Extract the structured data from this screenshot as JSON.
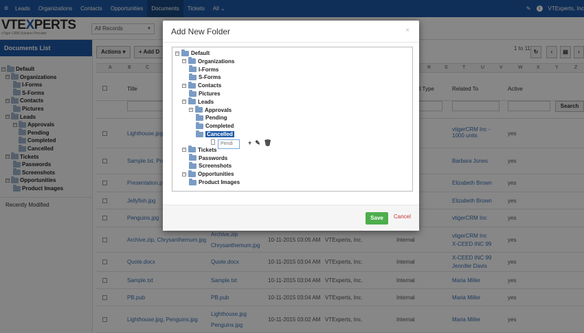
{
  "nav": {
    "menu_icon": "grid-icon",
    "items": [
      "Leads",
      "Organizations",
      "Contacts",
      "Opportunities",
      "Documents",
      "Tickets",
      "All"
    ],
    "active": "Documents",
    "user": "VTExperts, Inc"
  },
  "logo": {
    "text_a": "VTE",
    "text_x": "X",
    "text_b": "PERTS",
    "tagline": "vTiger CRM Solution Provider"
  },
  "records": {
    "value": "All Records"
  },
  "sidebar": {
    "title": "Documents List",
    "tree": [
      {
        "label": "Default",
        "level": 0
      },
      {
        "label": "Organizations",
        "level": 1
      },
      {
        "label": "I-Forms",
        "level": 2
      },
      {
        "label": "S-Forms",
        "level": 2
      },
      {
        "label": "Contacts",
        "level": 1
      },
      {
        "label": "Pictures",
        "level": 2
      },
      {
        "label": "Leads",
        "level": 1
      },
      {
        "label": "Approvals",
        "level": 2
      },
      {
        "label": "Pending",
        "level": 3
      },
      {
        "label": "Completed",
        "level": 3
      },
      {
        "label": "Cancelled",
        "level": 3
      },
      {
        "label": "Tickets",
        "level": 1
      },
      {
        "label": "Passwords",
        "level": 2
      },
      {
        "label": "Screenshots",
        "level": 2
      },
      {
        "label": "Opportunities",
        "level": 1
      },
      {
        "label": "Product Images",
        "level": 2
      }
    ],
    "recent": "Recently Modified"
  },
  "toolbar": {
    "actions": "Actions",
    "add": "+ Add D"
  },
  "pager": {
    "range": "1 to 11"
  },
  "alphabet": [
    "A",
    "B",
    "C",
    "R",
    "S",
    "T",
    "U",
    "V",
    "W",
    "X",
    "Y",
    "Z"
  ],
  "table": {
    "headers": {
      "title": "Title",
      "type": "d Type",
      "related": "Related To",
      "active": "Active"
    },
    "search": "Search",
    "rows": [
      {
        "title": "Lighthouse.jpg, ...",
        "file": "",
        "modified": "",
        "owner": "",
        "type": "",
        "related": "vtigerCRM Inc - 1000 units",
        "active": "yes"
      },
      {
        "title": "Sample.txt, Prop",
        "file": "",
        "modified": "",
        "owner": "",
        "type": "",
        "related": "Barbara Jones",
        "active": "yes"
      },
      {
        "title": "Presentation.pp",
        "file": "",
        "modified": "",
        "owner": "",
        "type": "",
        "related": "Elizabeth Brown",
        "active": "yes"
      },
      {
        "title": "Jellyfish.jpg",
        "file": "",
        "modified": "",
        "owner": "",
        "type": "",
        "related": "Elizabeth Brown",
        "active": "yes"
      },
      {
        "title": "Penguins.jpg",
        "file": "",
        "modified": "",
        "owner": "",
        "type": "",
        "related": "vtigerCRM Inc",
        "active": "yes"
      },
      {
        "title": "Archive.zip, Chrysanthemum.jpg",
        "file": "Archive.zip",
        "file2": "Chrysanthemum.jpg",
        "modified": "10-11-2015 03:05 AM",
        "owner": "VTExperts, Inc.",
        "type": "Internal",
        "related": "vtigerCRM Inc",
        "related2": "X-CEED INC 99",
        "active": "yes"
      },
      {
        "title": "Quote.docx",
        "file": "Quote.docx",
        "modified": "10-11-2015 03:04 AM",
        "owner": "VTExperts, Inc.",
        "type": "Internal",
        "related": "X-CEED INC 99",
        "related2": "Jennifer Davis",
        "active": "yes"
      },
      {
        "title": "Sample.txt",
        "file": "Sample.txt",
        "modified": "10-11-2015 03:04 AM",
        "owner": "VTExperts, Inc.",
        "type": "Internal",
        "related": "Maria Miller",
        "active": "yes"
      },
      {
        "title": "PB.pub",
        "file": "PB.pub",
        "modified": "10-11-2015 03:04 AM",
        "owner": "VTExperts, Inc.",
        "type": "Internal",
        "related": "Maria Miller",
        "active": "yes"
      },
      {
        "title": "Lighthouse.jpg, Penguins.jpg",
        "file": "Lighthouse.jpg",
        "file2": "Penguins.jpg",
        "modified": "10-11-2015 03:02 AM",
        "owner": "VTExperts, Inc.",
        "type": "Internal",
        "related": "Maria Miller",
        "active": "yes"
      }
    ]
  },
  "modal": {
    "title": "Add New Folder",
    "close": "×",
    "tree": [
      {
        "label": "Default"
      },
      {
        "label": "Organizations"
      },
      {
        "label": "I-Forms"
      },
      {
        "label": "S-Forms"
      },
      {
        "label": "Contacts"
      },
      {
        "label": "Pictures"
      },
      {
        "label": "Leads"
      },
      {
        "label": "Approvals"
      },
      {
        "label": "Pending"
      },
      {
        "label": "Completed"
      },
      {
        "label": "Cancelled",
        "selected": true
      },
      {
        "label": "Tickets"
      },
      {
        "label": "Passwords"
      },
      {
        "label": "Screenshots"
      },
      {
        "label": "Opportunities"
      },
      {
        "label": "Product Images"
      }
    ],
    "new_folder_value": "Pendi",
    "save": "Save",
    "cancel": "Cancel"
  }
}
